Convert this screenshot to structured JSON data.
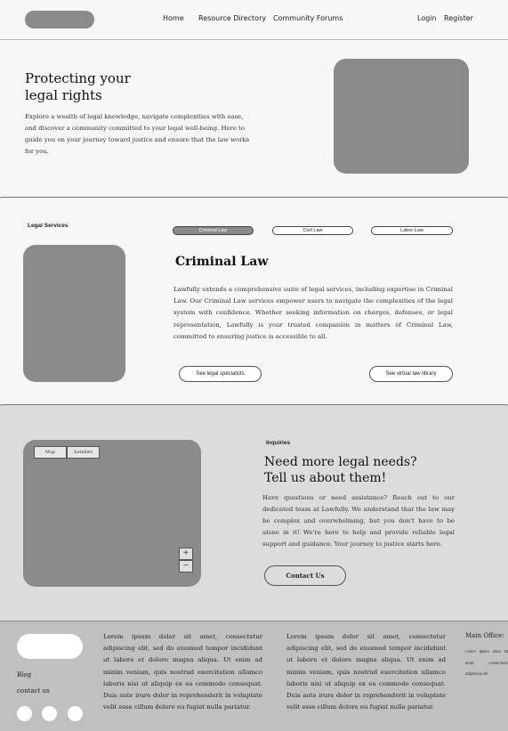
{
  "nav": {
    "home": "Home",
    "resources": "Resource Directory",
    "forums": "Community Forums",
    "login": "Login",
    "register": "Register"
  },
  "hero": {
    "title_line1": "Protecting your",
    "title_line2": "legal rights",
    "text": "Explore a wealth of legal knowledge, navigate complexities with ease, and discover a community committed to your legal well-being. Here to guide you on your journey toward justice and ensure that the law works for you."
  },
  "services": {
    "label": "Legal Services",
    "tabs": [
      {
        "label": "Criminal Law",
        "active": true
      },
      {
        "label": "Civil Law",
        "active": false
      },
      {
        "label": "Labor Law",
        "active": false
      }
    ],
    "title": "Criminal Law",
    "text": "Lawfully extends a comprehensive suite of legal services, including expertise in Criminal Law. Our Criminal Law services empower users to navigate the complexities of the legal system with confidence. Whether seeking information on charges, defenses, or legal representation, Lawfully is your trusted companion in matters of Criminal Law, committed to ensuring justice is accessible to all.",
    "specialists_button": "See legal specialists",
    "library_button": "See virtual law library"
  },
  "inquiries": {
    "label": "Inquiries",
    "title_line1": "Need more legal needs?",
    "title_line2": "Tell us about them!",
    "text": "Have questions or need assistance? Reach out to our dedicated team at Lawfully. We understand that the law may be complex and overwhelming, but you don't have to be alone in it! We're here to help and provide reliable legal support and guidance. Your journey to justice starts here.",
    "contact_button": "Contact Us",
    "map": {
      "map_button": "Map",
      "satellite_button": "Satellite",
      "zoom_in": "+",
      "zoom_out": "−"
    }
  },
  "footer": {
    "blog": "Blog",
    "contact": "contact us",
    "col1": "Lorem ipsum dolor sit amet, consectetur adipiscing elit, sed do eiusmod tempor incididunt ut labore et dolore magna aliqua. Ut enim ad minim veniam, quis nostrud exercitation ullamco laboris nisi ut aliquip ex ea commodo consequat. Duis aute irure dolor in reprehenderit in voluptate velit esse cillum dolore eu fugiat nulla pariatur.",
    "col2": "Lorem ipsum dolor sit amet, consectetur adipiscing elit, sed do eiusmod tempor incididunt ut labore et dolore magna aliqua. Ut enim ad minim veniam, quis nostrud exercitation ullamco laboris nisi ut aliquip ex ea commodo consequat. Duis aute irure dolor in reprehenderit in voluptate velit esse cillum dolore eu fugiat nulla pariatur.",
    "office_title": "Main Office:",
    "office_text": "Lorem ipsum dolor sit amet, consectetur adipiscing elit"
  }
}
